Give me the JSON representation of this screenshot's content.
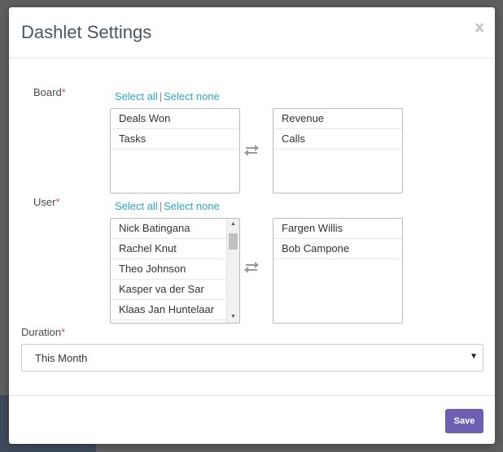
{
  "modal": {
    "title": "Dashlet Settings",
    "close_label": "x"
  },
  "board": {
    "label": "Board",
    "required_mark": "*",
    "select_all": "Select all",
    "separator": "|",
    "select_none": "Select none",
    "available": [
      "Deals Won",
      "Tasks"
    ],
    "selected": [
      "Revenue",
      "Calls"
    ]
  },
  "user": {
    "label": "User",
    "required_mark": "*",
    "select_all": "Select all",
    "separator": "|",
    "select_none": "Select none",
    "available": [
      "Nick Batingana",
      "Rachel Knut",
      "Theo Johnson",
      "Kasper va der Sar",
      "Klaas Jan Huntelaar"
    ],
    "selected": [
      "Fargen Willis",
      "Bob Campone"
    ]
  },
  "duration": {
    "label": "Duration",
    "required_mark": "*",
    "value": "This Month"
  },
  "footer": {
    "save_label": "Save"
  },
  "colors": {
    "accent": "#6f5fb2",
    "link": "#2ba6cb",
    "required": "#d9534f"
  }
}
